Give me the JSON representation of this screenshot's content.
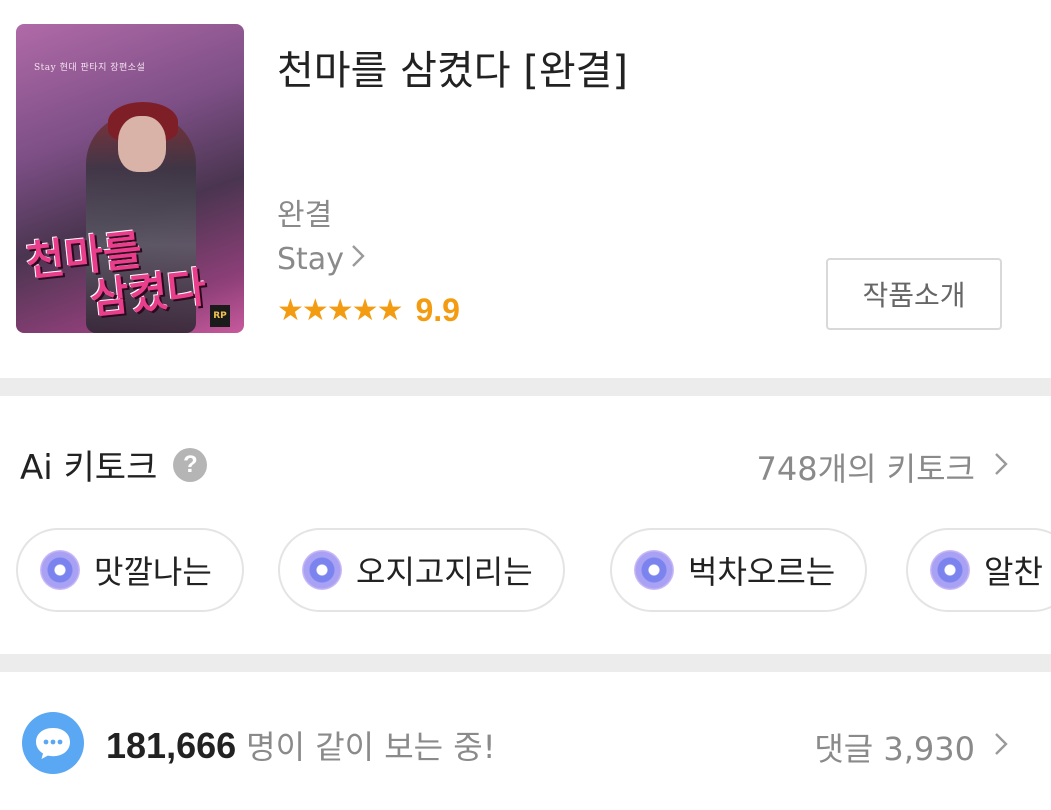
{
  "book": {
    "title": "천마를 삼켰다 [완결]",
    "cover_top_text": "Stay 현대 판타지 장편소설",
    "cover_title_line1": "천마를",
    "cover_title_line2": "삼켰다",
    "cover_badge": "RP",
    "status": "완결",
    "author": "Stay",
    "stars": "★★★★★",
    "rating": "9.9",
    "intro_button": "작품소개"
  },
  "keytalk": {
    "title": "Ai 키토크",
    "help": "?",
    "count_text": "748개의 키토크",
    "chips": [
      "맛깔나는",
      "오지고지리는",
      "벅차오르는",
      "알찬"
    ]
  },
  "footer": {
    "viewers_number": "181,666",
    "viewers_suffix": "명이 같이 보는 중!",
    "comments": "댓글 3,930"
  },
  "colors": {
    "rating": "#f39c12",
    "bubble": "#5aa7f4",
    "divider": "#ececec"
  }
}
